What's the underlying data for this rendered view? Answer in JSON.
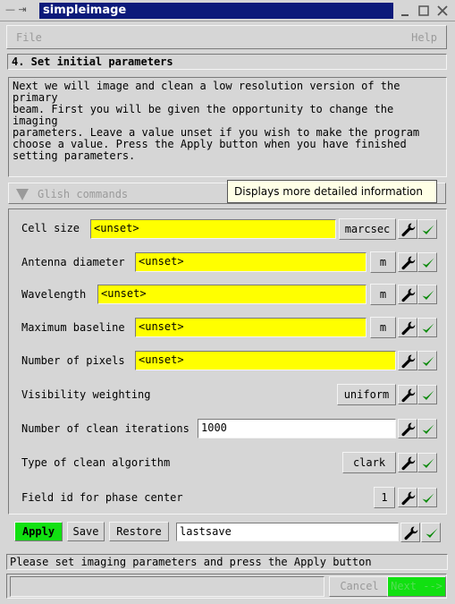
{
  "window": {
    "title": "simpleimage",
    "left_glyphs": "— ⇥",
    "minimize_glyph": "□",
    "maximize_glyph": "□",
    "close_glyph": "✕"
  },
  "menu": {
    "file": "File",
    "help": "Help"
  },
  "step_title": "4. Set initial parameters",
  "description": "Next we will image and clean a low resolution version of the primary\nbeam. First you will be given the opportunity to change the imaging\nparameters. Leave a value unset if you wish to make the program\nchoose a value. Press the Apply button when you have finished\nsetting parameters.",
  "glish_label": "Glish commands",
  "tooltip": "Displays more detailed information",
  "params": [
    {
      "label": "Cell size",
      "value": "<unset>",
      "unit": "marcsec"
    },
    {
      "label": "Antenna diameter",
      "value": "<unset>",
      "unit": "m"
    },
    {
      "label": "Wavelength",
      "value": "<unset>",
      "unit": "m"
    },
    {
      "label": "Maximum baseline",
      "value": "<unset>",
      "unit": "m"
    },
    {
      "label": "Number of pixels",
      "value": "<unset>",
      "unit": ""
    },
    {
      "label": "Visibility weighting",
      "value": "",
      "unit": "uniform"
    },
    {
      "label": "Number of clean iterations",
      "value": "1000",
      "unit": ""
    },
    {
      "label": "Type of clean algorithm",
      "value": "",
      "unit": "clark"
    },
    {
      "label": "Field id for phase center",
      "value": "",
      "unit": "1"
    }
  ],
  "actions": {
    "apply": "Apply",
    "save": "Save",
    "restore": "Restore",
    "save_name": "lastsave"
  },
  "status": "Please set imaging parameters and press the Apply button",
  "footer": {
    "cancel": "Cancel",
    "next": "Next -->"
  },
  "colors": {
    "field_yellow": "#ffff00",
    "apply_green": "#11e011",
    "check_green": "#0a8a0a",
    "title_blue": "#0c1a7a"
  }
}
